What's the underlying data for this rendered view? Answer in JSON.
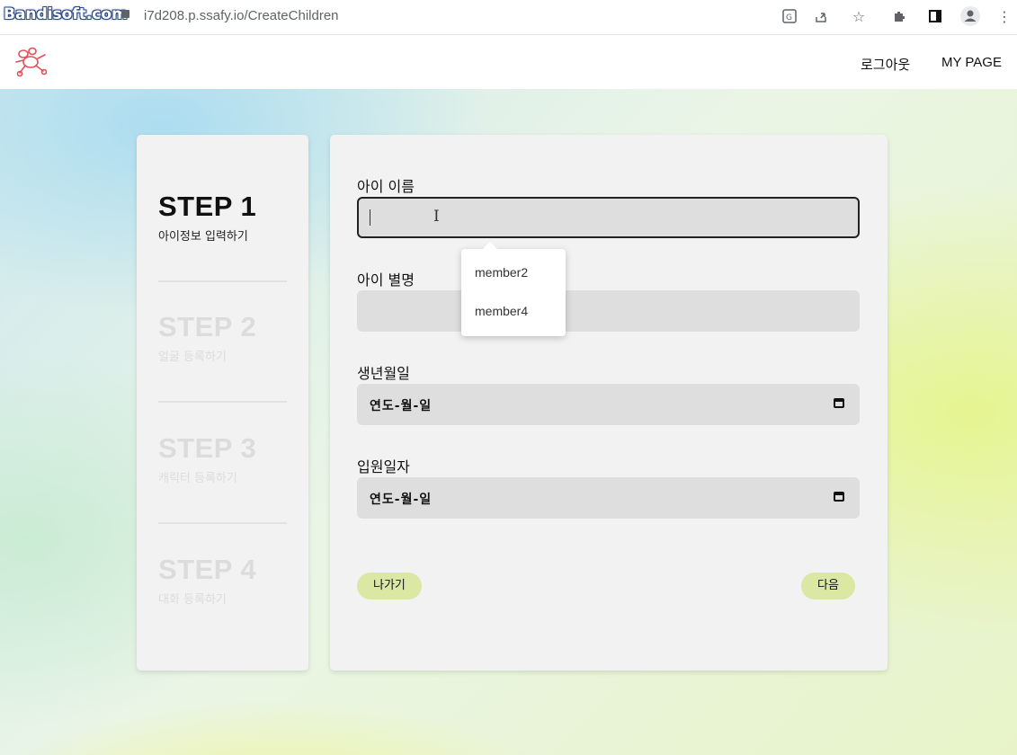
{
  "browser": {
    "watermark": "Bandisoft.com",
    "url": "i7d208.p.ssafy.io/CreateChildren",
    "icons": [
      "translate-icon",
      "share-icon",
      "star-icon",
      "extensions-icon",
      "sidepanel-icon",
      "profile-icon",
      "menu-icon"
    ]
  },
  "header": {
    "logo": "rabbit-logo-icon",
    "logout": "로그아웃",
    "mypage": "MY PAGE"
  },
  "steps": [
    {
      "title": "STEP 1",
      "subtitle": "아이정보 입력하기",
      "active": true
    },
    {
      "title": "STEP 2",
      "subtitle": "얼굴 등록하기",
      "active": false
    },
    {
      "title": "STEP 3",
      "subtitle": "캐릭터 등록하기",
      "active": false
    },
    {
      "title": "STEP 4",
      "subtitle": "대화 등록하기",
      "active": false
    }
  ],
  "form": {
    "name_label": "아이 이름",
    "name_value": "",
    "nickname_label": "아이 별명",
    "nickname_value": "",
    "birth_label": "생년월일",
    "birth_value": "연도-월-일",
    "admission_label": "입원일자",
    "admission_value": "연도-월-일",
    "exit_button": "나가기",
    "next_button": "다음"
  },
  "autocomplete": {
    "options": [
      "member2",
      "member4"
    ]
  },
  "colors": {
    "panel": "#f2f2f2",
    "input": "#dedede",
    "button": "#dbe8a4"
  }
}
